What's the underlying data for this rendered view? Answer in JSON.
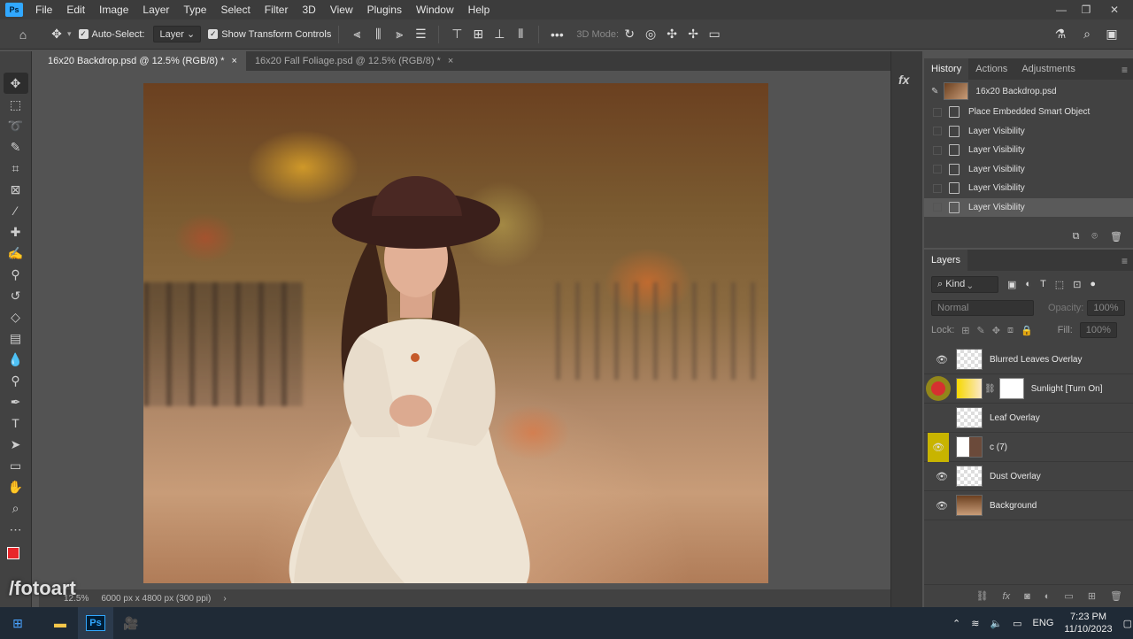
{
  "app": {
    "logo": "Ps"
  },
  "menu": [
    "File",
    "Edit",
    "Image",
    "Layer",
    "Type",
    "Select",
    "Filter",
    "3D",
    "View",
    "Plugins",
    "Window",
    "Help"
  ],
  "window_controls": {
    "minimize": "—",
    "restore": "❐",
    "close": "✕"
  },
  "options": {
    "auto_select_label": "Auto-Select:",
    "auto_select_target": "Layer",
    "show_transform_label": "Show Transform Controls",
    "mode_3d_label": "3D Mode:"
  },
  "tabs": [
    {
      "label": "16x20 Backdrop.psd @ 12.5% (RGB/8) *",
      "close": "×"
    },
    {
      "label": "16x20 Fall Foliage.psd @ 12.5% (RGB/8) *",
      "close": "×"
    }
  ],
  "status": {
    "zoom": "12.5%",
    "doc_info": "6000 px x 4800 px (300 ppi)",
    "arrow": "›"
  },
  "history": {
    "tabs": [
      "History",
      "Actions",
      "Adjustments"
    ],
    "snapshot": "16x20 Backdrop.psd",
    "rows": [
      "Place Embedded Smart Object",
      "Layer Visibility",
      "Layer Visibility",
      "Layer Visibility",
      "Layer Visibility",
      "Layer Visibility"
    ]
  },
  "layers": {
    "title": "Layers",
    "filter_kind": "Kind",
    "blend_mode": "Normal",
    "opacity_label": "Opacity:",
    "opacity_value": "100%",
    "lock_label": "Lock:",
    "fill_label": "Fill:",
    "fill_value": "100%",
    "rows": [
      {
        "name": "Blurred Leaves Overlay",
        "visible": true
      },
      {
        "name": "Sunlight [Turn On]",
        "visible": false
      },
      {
        "name": "Leaf Overlay",
        "visible": false
      },
      {
        "name": "c (7)",
        "visible": true
      },
      {
        "name": "Dust Overlay",
        "visible": true
      },
      {
        "name": "Background",
        "visible": true
      }
    ]
  },
  "taskbar": {
    "language": "ENG",
    "time": "7:23 PM",
    "date": "11/10/2023"
  },
  "watermark": "/fotoart",
  "colors": {
    "foreground": "#e8262b",
    "accent": "#31a8ff",
    "highlight_red": "#d63030",
    "highlight_yellow": "#c8b400"
  }
}
